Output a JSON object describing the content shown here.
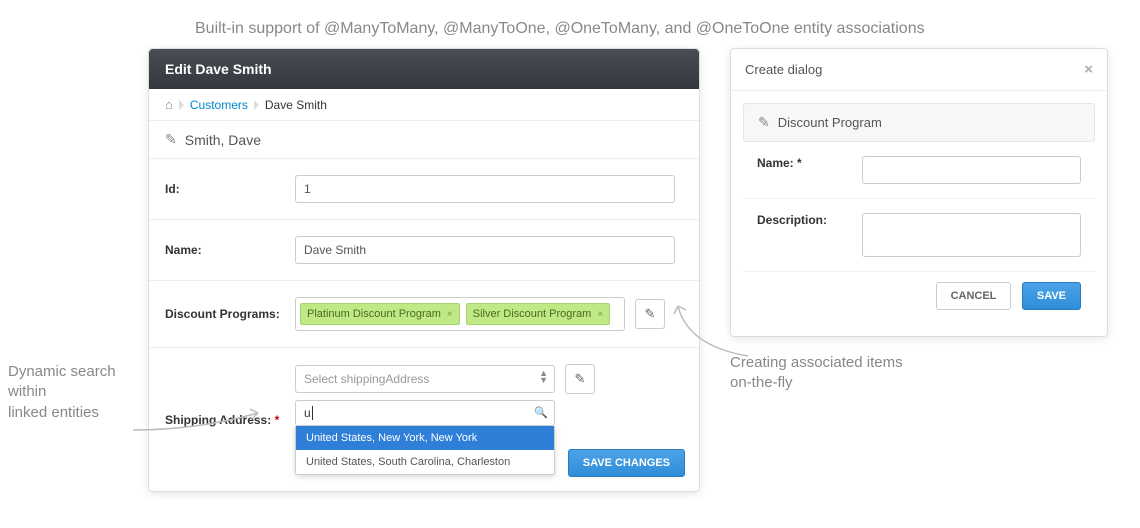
{
  "caption_top": "Built-in support of @ManyToMany, @ManyToOne, @OneToMany, and @OneToOne entity associations",
  "main": {
    "title": "Edit Dave Smith",
    "breadcrumb": {
      "customers": "Customers",
      "current": "Dave Smith"
    },
    "sub_header": "Smith, Dave",
    "fields": {
      "id_label": "Id:",
      "id_value": "1",
      "name_label": "Name:",
      "name_value": "Dave Smith",
      "discount_label": "Discount Programs:",
      "tags": [
        {
          "label": "Platinum Discount Program"
        },
        {
          "label": "Silver Discount Program"
        }
      ],
      "shipping_label": "Shipping Address:",
      "shipping_placeholder": "Select shippingAddress",
      "search_value": "u",
      "dropdown": [
        "United States, New York, New York",
        "United States, South Carolina, Charleston"
      ]
    },
    "footer": {
      "save": "SAVE CHANGES"
    }
  },
  "dialog": {
    "title": "Create dialog",
    "sub": "Discount Program",
    "name_label": "Name:",
    "desc_label": "Description:",
    "cancel": "CANCEL",
    "save": "SAVE"
  },
  "annotations": {
    "left": "Dynamic search within\nlinked entities",
    "right": "Creating associated items\non-the-fly"
  }
}
